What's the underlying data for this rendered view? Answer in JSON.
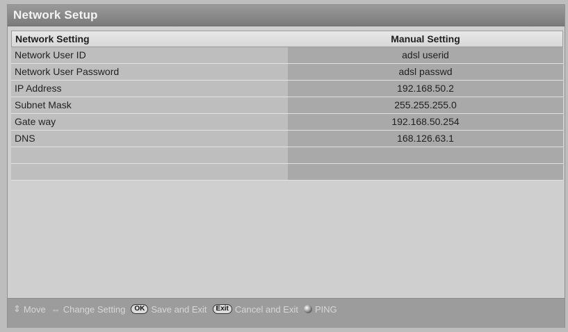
{
  "window": {
    "title": "Network Setup"
  },
  "table": {
    "header": {
      "left": "Network Setting",
      "right": "Manual Setting"
    },
    "rows": [
      {
        "label": "Network User ID",
        "value": "adsl userid"
      },
      {
        "label": "Network User Password",
        "value": "adsl passwd"
      },
      {
        "label": "IP Address",
        "value": "192.168.50.2"
      },
      {
        "label": "Subnet Mask",
        "value": "255.255.255.0"
      },
      {
        "label": "Gate way",
        "value": "192.168.50.254"
      },
      {
        "label": "DNS",
        "value": "168.126.63.1"
      },
      {
        "label": "",
        "value": ""
      },
      {
        "label": "",
        "value": ""
      }
    ]
  },
  "footer": {
    "move": "Move",
    "change_setting": "Change Setting",
    "ok_key": "OK",
    "save_exit": "Save and Exit",
    "exit_key": "Exit",
    "cancel_exit": "Cancel and Exit",
    "ping": "PING",
    "icons": {
      "move": "up-down-arrow-icon",
      "change": "left-right-arrow-icon",
      "ping": "red-dot-icon"
    }
  }
}
